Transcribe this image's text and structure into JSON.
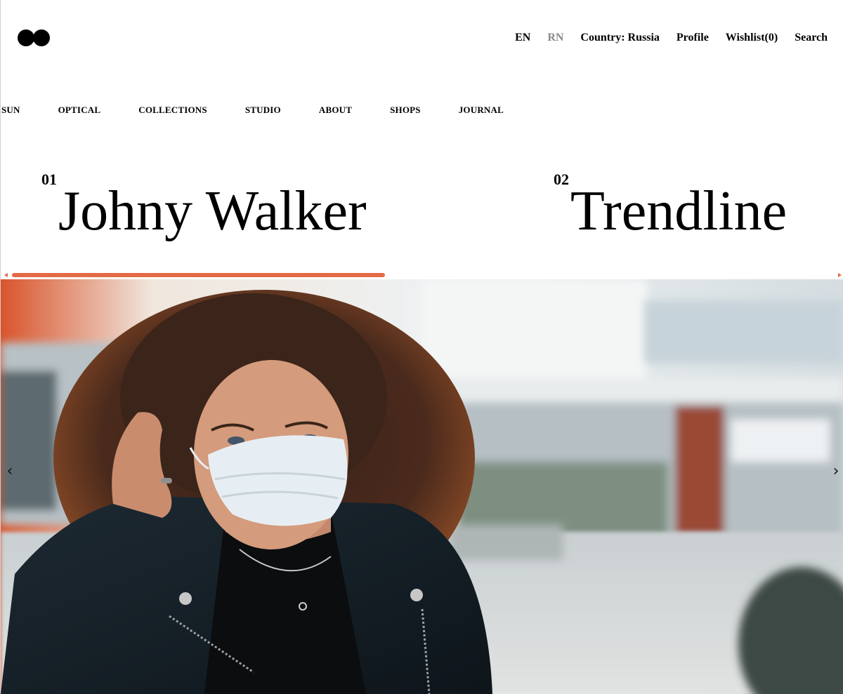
{
  "header": {
    "nav": [
      {
        "label": "EN",
        "active": true
      },
      {
        "label": "RN",
        "active": false
      },
      {
        "label": "Country: Russia"
      },
      {
        "label": "Profile"
      },
      {
        "label": "Wishlist(0)"
      },
      {
        "label": "Search"
      }
    ]
  },
  "main_nav": [
    "SUN",
    "OPTICAL",
    "COLLECTIONS",
    "STUDIO",
    "ABOUT",
    "SHOPS",
    "JOURNAL"
  ],
  "slider": {
    "slides": [
      {
        "number": "01",
        "title": "Johny Walker"
      },
      {
        "number": "02",
        "title": "Trendline"
      }
    ],
    "progress": 0.455,
    "accent_color": "#e36b45"
  },
  "hero": {
    "image_subject": "woman-with-face-mask-photo",
    "prev_icon": "chevron-left-icon",
    "next_icon": "chevron-right-icon",
    "prev_glyph": "‹",
    "next_glyph": "›"
  }
}
